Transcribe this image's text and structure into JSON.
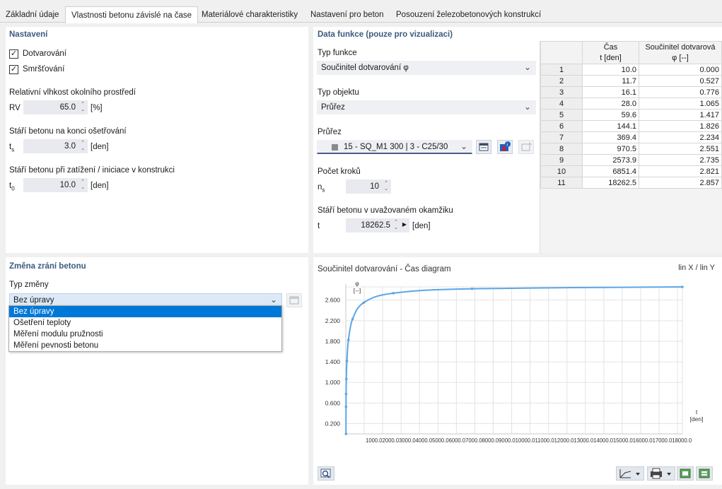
{
  "tabs": [
    "Základní údaje",
    "Vlastnosti betonu závislé na čase",
    "Materiálové charakteristiky",
    "Nastavení pro beton",
    "Posouzení železobetonových konstrukcí"
  ],
  "settings": {
    "title": "Nastavení",
    "creep_label": "Dotvarování",
    "shrink_label": "Smršťování",
    "rh_heading": "Relativní vlhkost okolního prostředí",
    "rh_sym": "RV",
    "rh_value": "65.0",
    "rh_unit": "[%]",
    "ts_heading": "Stáří betonu na konci ošetřování",
    "ts_sym": "t",
    "ts_sub": "s",
    "ts_value": "3.0",
    "ts_unit": "[den]",
    "t0_heading": "Stáří betonu při zatížení / iniciace v konstrukci",
    "t0_sym": "t",
    "t0_sub": "0",
    "t0_value": "10.0",
    "t0_unit": "[den]"
  },
  "function": {
    "title": "Data funkce (pouze pro vizualizaci)",
    "type_label": "Typ funkce",
    "type_value": "Součinitel dotvarování φ",
    "obj_label": "Typ objektu",
    "obj_value": "Průřez",
    "section_label": "Průřez",
    "section_value": "15 - SQ_M1 300 | 3 - C25/30",
    "steps_label": "Počet kroků",
    "steps_sym": "n",
    "steps_sub": "s",
    "steps_value": "10",
    "age_label": "Stáří betonu v uvažovaném okamžiku",
    "age_sym": "t",
    "age_value": "18262.5",
    "age_unit": "[den]"
  },
  "table": {
    "col1_line1": "Čas",
    "col1_line2": "t [den]",
    "col2_line1": "Součinitel dotvarová",
    "col2_line2": "φ [--]",
    "rows": [
      [
        "1",
        "10.0",
        "0.000"
      ],
      [
        "2",
        "11.7",
        "0.527"
      ],
      [
        "3",
        "16.1",
        "0.776"
      ],
      [
        "4",
        "28.0",
        "1.065"
      ],
      [
        "5",
        "59.6",
        "1.417"
      ],
      [
        "6",
        "144.1",
        "1.826"
      ],
      [
        "7",
        "369.4",
        "2.234"
      ],
      [
        "8",
        "970.5",
        "2.551"
      ],
      [
        "9",
        "2573.9",
        "2.735"
      ],
      [
        "10",
        "6851.4",
        "2.821"
      ],
      [
        "11",
        "18262.5",
        "2.857"
      ]
    ]
  },
  "maturity": {
    "title": "Změna zrání betonu",
    "type_label": "Typ změny",
    "selected": "Bez úpravy",
    "options": [
      "Bez úpravy",
      "Ošetření teploty",
      "Měření modulu pružnosti",
      "Měření pevnosti betonu"
    ]
  },
  "diagram": {
    "title": "Součinitel dotvarování - Čas diagram",
    "scale": "lin X / lin Y"
  },
  "chart_data": {
    "type": "line",
    "title": "Součinitel dotvarování - Čas diagram",
    "ylabel_line1": "φ",
    "ylabel_line2": "[--]",
    "xlabel_line1": "t",
    "xlabel_line2": "[den]",
    "x": [
      10.0,
      11.7,
      16.1,
      28.0,
      59.6,
      144.1,
      369.4,
      970.5,
      2573.9,
      6851.4,
      18262.5
    ],
    "y": [
      0.0,
      0.527,
      0.776,
      1.065,
      1.417,
      1.826,
      2.234,
      2.551,
      2.735,
      2.821,
      2.857
    ],
    "xlim": [
      0,
      18262.5
    ],
    "ylim": [
      0,
      2.857
    ],
    "xticks": [
      1000,
      2000,
      3000,
      4000,
      5000,
      6000,
      7000,
      8000,
      9000,
      10000,
      11000,
      12000,
      13000,
      14000,
      15000,
      16000,
      17000,
      18000
    ],
    "xtick_labels": "1000.02000.03000.04000.05000.06000.07000.08000.09000.010000.011000.012000.013000.014000.015000.016000.017000.018000.0",
    "yticks": [
      0.2,
      0.6,
      1.0,
      1.4,
      1.8,
      2.2,
      2.6
    ],
    "ytick_labels": [
      "0.200",
      "0.600",
      "1.000",
      "1.400",
      "1.800",
      "2.200",
      "2.600"
    ],
    "grid": true,
    "colors": {
      "line": "#5ba6e6"
    }
  }
}
